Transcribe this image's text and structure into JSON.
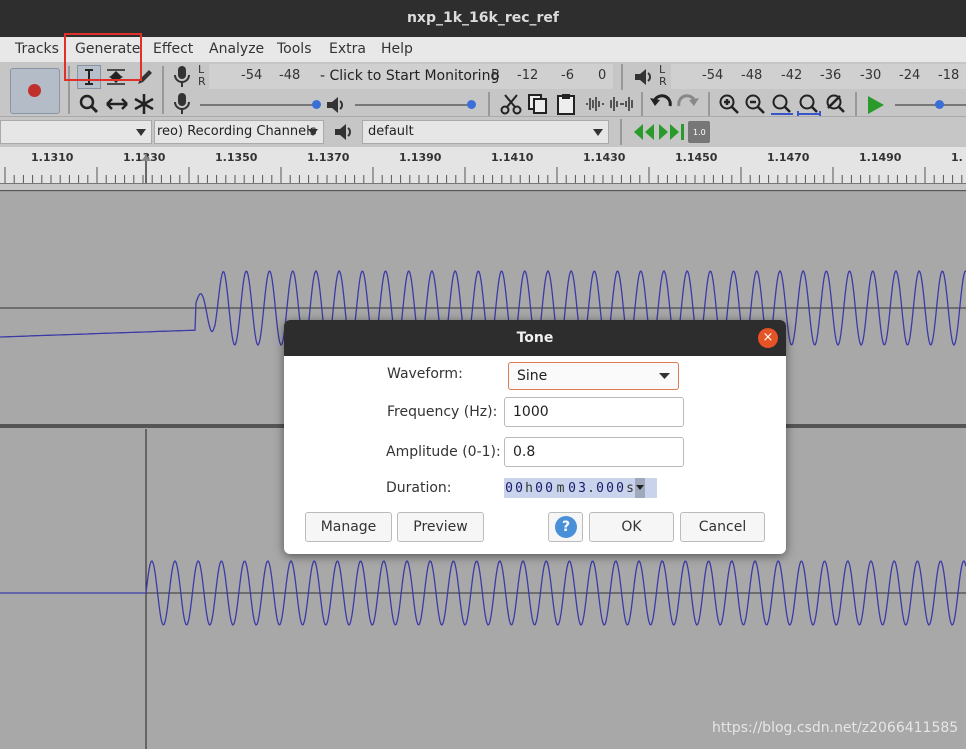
{
  "window": {
    "title": "nxp_1k_16k_rec_ref"
  },
  "menu": [
    "Tracks",
    "Generate",
    "Effect",
    "Analyze",
    "Tools",
    "Extra",
    "Help"
  ],
  "meter_rec": {
    "lr_left": "L",
    "lr_right": "R",
    "values": [
      "-54",
      "-48"
    ],
    "monitor_text": "- Click to Start Monitoring",
    "values2": [
      "B",
      "-12",
      "-6",
      "0"
    ]
  },
  "meter_play": {
    "lr_left": "L",
    "lr_right": "R",
    "values": [
      "-54",
      "-48",
      "-42",
      "-36",
      "-30",
      "-24",
      "-18"
    ]
  },
  "device": {
    "channels": "reo) Recording Channels",
    "output": "default"
  },
  "ruler": {
    "ticks": [
      "1.1310",
      "1.1330",
      "1.1350",
      "1.1370",
      "1.1390",
      "1.1410",
      "1.1430",
      "1.1450",
      "1.1470",
      "1.1490",
      "1."
    ]
  },
  "dialog": {
    "title": "Tone",
    "close_symbol": "×",
    "waveform_label": "Waveform:",
    "waveform_value": "Sine",
    "frequency_label": "Frequency (Hz):",
    "frequency_value": "1000",
    "amplitude_label": "Amplitude (0-1):",
    "amplitude_value": "0.8",
    "duration_label": "Duration:",
    "duration_digits": [
      "0",
      "0",
      "h",
      "0",
      "0",
      "m",
      "0",
      "3",
      ".",
      "0",
      "0",
      "0",
      "s"
    ],
    "manage_label": "Manage",
    "preview_label": "Preview",
    "help_symbol": "?",
    "ok_label": "OK",
    "cancel_label": "Cancel"
  },
  "watermark": "https://blog.csdn.net/z2066411585",
  "colors": {
    "waveform": "#3b3ba8",
    "highlight": "#e0302a",
    "accent": "#e65324",
    "help": "#4a90d9"
  }
}
